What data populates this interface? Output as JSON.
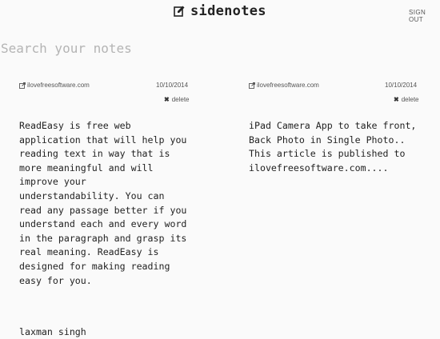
{
  "header": {
    "title": "sidenotes",
    "logo_icon": "edit-note-icon",
    "signout_label": "SIGN OUT"
  },
  "search": {
    "placeholder": "Search your notes",
    "value": ""
  },
  "notes": [
    {
      "source": "ilovefreesoftware.com",
      "date": "10/10/2014",
      "delete_label": "delete",
      "body": "ReadEasy is free web\napplication that will help you\nreading text in way that is\nmore meaningful and will\nimprove your\nunderstandability. You can\nread any passage better if you\nunderstand each and every word\nin the paragraph and grasp its\nreal meaning. ReadEasy is\ndesigned for making reading\neasy for you.",
      "author": "laxman singh"
    },
    {
      "source": "ilovefreesoftware.com",
      "date": "10/10/2014",
      "delete_label": "delete",
      "body": "iPad Camera App to take front,\nBack Photo in Single Photo..\nThis article is published to\nilovefreesoftware.com...."
    }
  ],
  "colors": {
    "background": "#fafafa",
    "text": "#222222",
    "muted": "#555555",
    "placeholder": "#b4b4b4"
  }
}
